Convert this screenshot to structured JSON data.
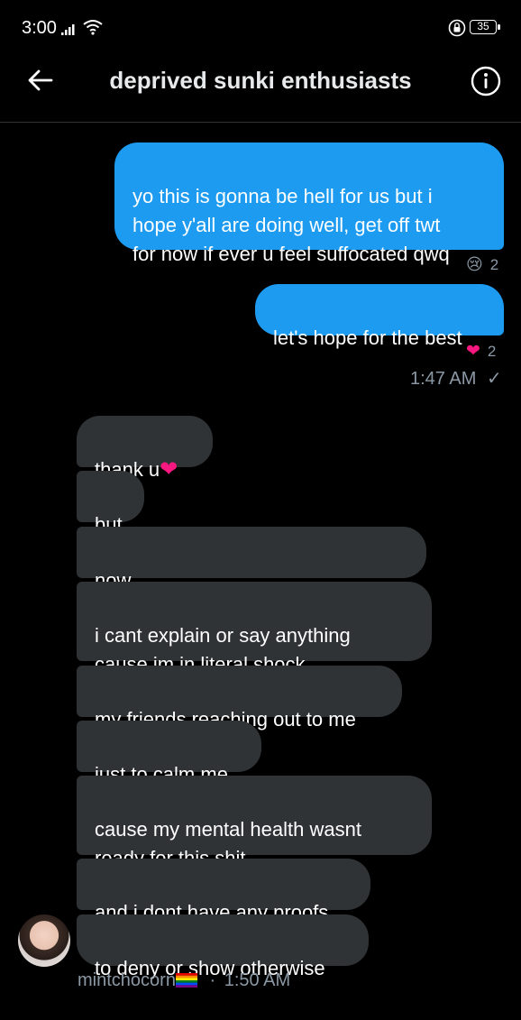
{
  "status_bar": {
    "time": "3:00",
    "battery": "35",
    "icons": [
      "signal-icon",
      "wifi-icon",
      "alarm-icon",
      "battery-icon"
    ]
  },
  "header": {
    "title": "deprived sunki enthusiasts",
    "back_icon": "back-arrow-icon",
    "info_icon": "info-icon"
  },
  "outgoing": [
    {
      "text": "yo this is gonna be hell for us but i\nhope y'all are doing well, get off twt\nfor now if ever u feel suffocated qwq",
      "reaction": {
        "emoji": "😢",
        "count": "2"
      }
    },
    {
      "text": "let's hope for the best",
      "reaction": {
        "emoji": "❤",
        "count": "2"
      }
    }
  ],
  "outgoing_meta": {
    "time": "1:47 AM",
    "check": "✓"
  },
  "incoming": [
    {
      "text": "thank u",
      "emoji": "❤"
    },
    {
      "text": "but"
    },
    {
      "text": "now"
    },
    {
      "text": "i cant explain or say anything\ncause im in literal shock"
    },
    {
      "text": "my friends reaching out to me"
    },
    {
      "text": "just to calm me"
    },
    {
      "text": "cause my mental health wasnt\nready for this shit"
    },
    {
      "text": "and i dont have any proofs"
    },
    {
      "text": "to deny or show otherwise"
    }
  ],
  "incoming_meta": {
    "sender": "mintchocorn",
    "separator": "·",
    "time": "1:50 AM"
  },
  "colors": {
    "outgoing_bubble": "#1d9bf0",
    "incoming_bubble": "#2f3336",
    "muted_text": "#8b98a5",
    "heart": "#f91880"
  }
}
